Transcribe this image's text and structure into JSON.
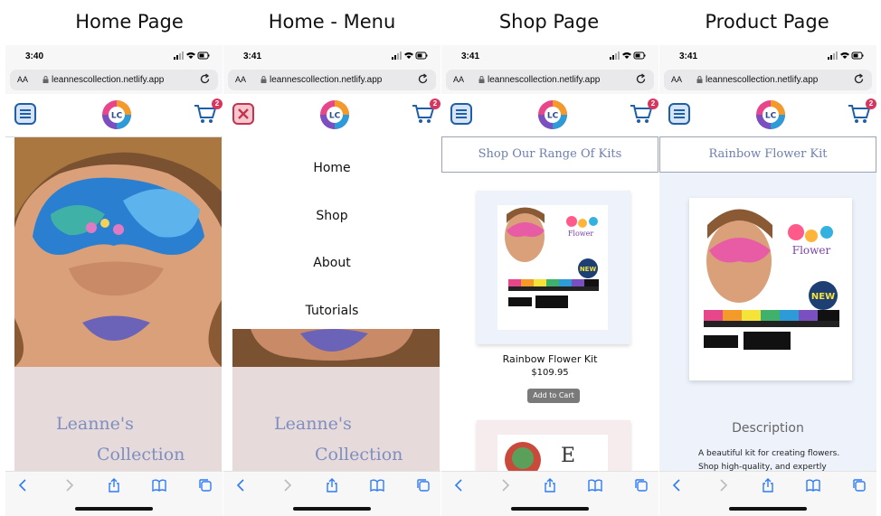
{
  "panels": [
    {
      "title": "Home Page",
      "time": "3:40",
      "url": "leannescollection.netlify.app"
    },
    {
      "title": "Home - Menu",
      "time": "3:41",
      "url": "leannescollection.netlify.app"
    },
    {
      "title": "Shop Page",
      "time": "3:41",
      "url": "leannescollection.netlify.app"
    },
    {
      "title": "Product Page",
      "time": "3:41",
      "url": "leannescollection.netlify.app"
    }
  ],
  "browser": {
    "text_size_label": "AA"
  },
  "logo_text": "LC",
  "cart_count": "2",
  "brand": {
    "line1": "Leanne's",
    "line2": "Collection"
  },
  "menu": {
    "items": [
      "Home",
      "Shop",
      "About",
      "Tutorials"
    ]
  },
  "shop": {
    "heading": "Shop Our Range Of Kits",
    "product_name": "Rainbow Flower Kit",
    "price": "$109.95",
    "add_to_cart": "Add to Cart"
  },
  "product": {
    "heading": "Rainbow Flower Kit",
    "description_title": "Description",
    "description_line1": "A beautiful kit for creating flowers.",
    "description_line2": "Shop high-quality, and expertly"
  },
  "colors": {
    "accent": "#7e8fbf",
    "badge": "#d9365f",
    "nav_icon": "#1f5fa8"
  }
}
